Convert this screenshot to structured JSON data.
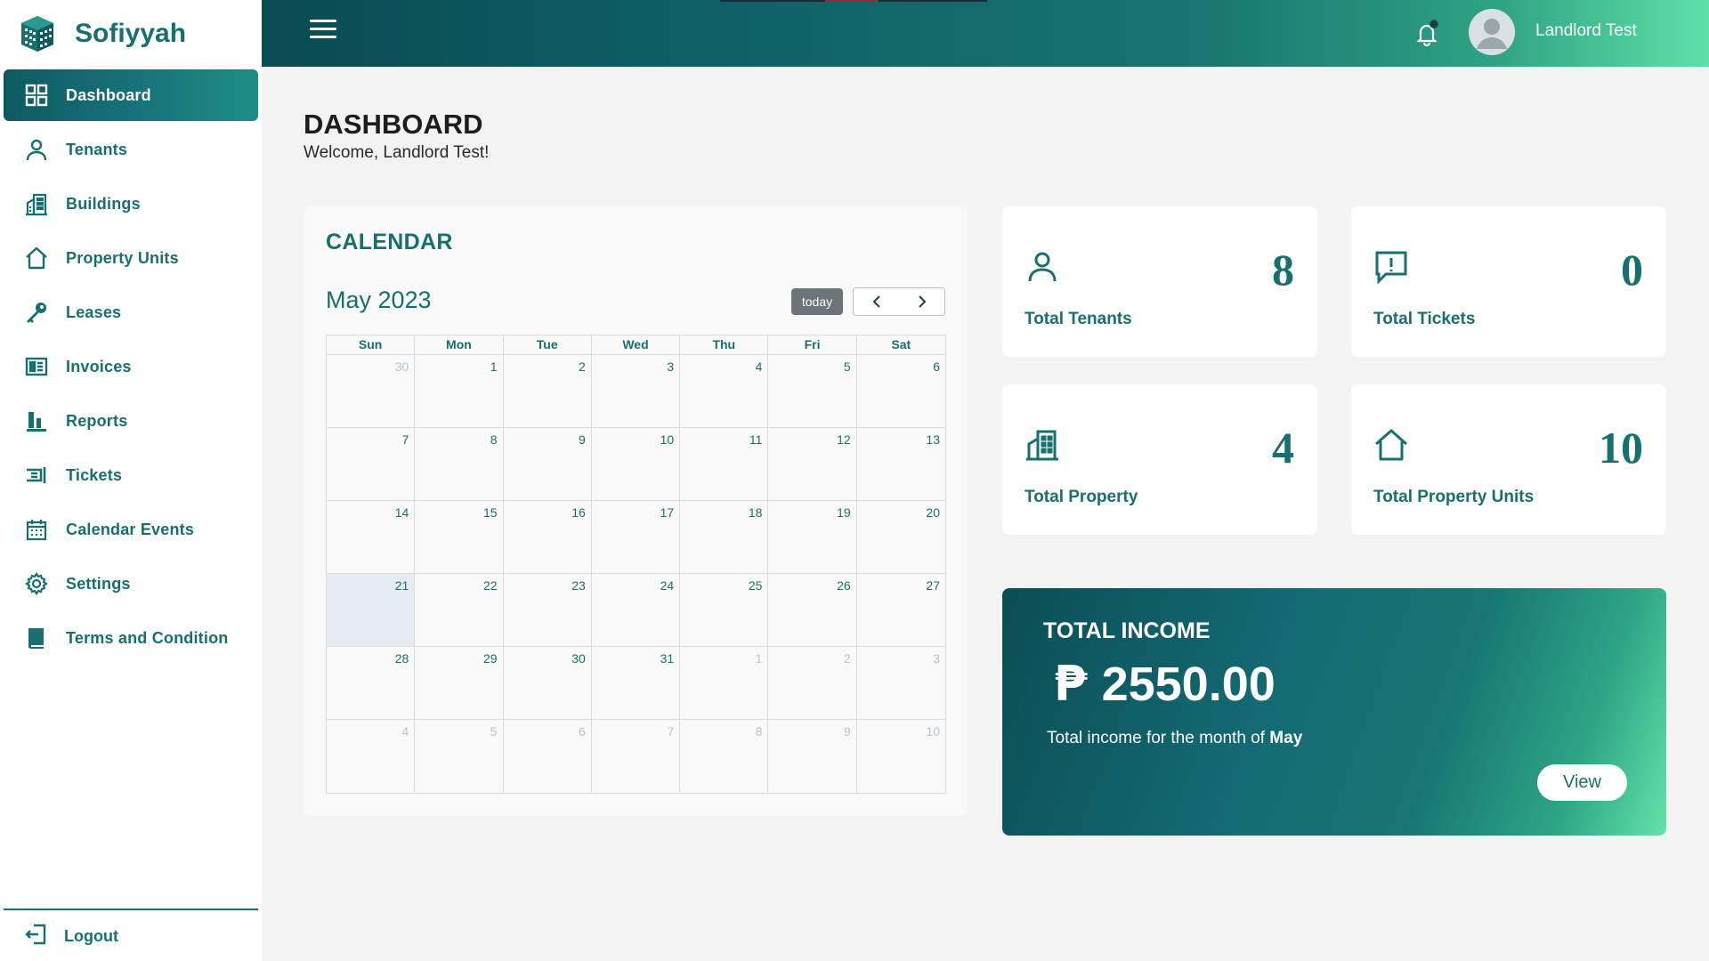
{
  "brand": {
    "name": "Sofiyyah",
    "logo_icon": "building-logo-icon"
  },
  "sidebar": {
    "items": [
      {
        "label": "Dashboard",
        "icon": "grid-icon",
        "active": true
      },
      {
        "label": "Tenants",
        "icon": "user-icon"
      },
      {
        "label": "Buildings",
        "icon": "building-icon"
      },
      {
        "label": "Property Units",
        "icon": "house-icon"
      },
      {
        "label": "Leases",
        "icon": "key-icon"
      },
      {
        "label": "Invoices",
        "icon": "invoice-icon"
      },
      {
        "label": "Reports",
        "icon": "bar-chart-icon"
      },
      {
        "label": "Tickets",
        "icon": "ticket-icon"
      },
      {
        "label": "Calendar Events",
        "icon": "calendar-icon"
      },
      {
        "label": "Settings",
        "icon": "gear-icon"
      },
      {
        "label": "Terms and Condition",
        "icon": "book-icon"
      }
    ],
    "logout_label": "Logout"
  },
  "topbar": {
    "user_name": "Landlord Test"
  },
  "header": {
    "title": "DASHBOARD",
    "welcome": "Welcome, Landlord Test!"
  },
  "calendar": {
    "title": "CALENDAR",
    "month_label": "May 2023",
    "today_label": "today",
    "prev_symbol": "‹",
    "next_symbol": "›",
    "weekdays": [
      "Sun",
      "Mon",
      "Tue",
      "Wed",
      "Thu",
      "Fri",
      "Sat"
    ],
    "weeks": [
      [
        "30",
        "1",
        "2",
        "3",
        "4",
        "5",
        "6"
      ],
      [
        "7",
        "8",
        "9",
        "10",
        "11",
        "12",
        "13"
      ],
      [
        "14",
        "15",
        "16",
        "17",
        "18",
        "19",
        "20"
      ],
      [
        "21",
        "22",
        "23",
        "24",
        "25",
        "26",
        "27"
      ],
      [
        "28",
        "29",
        "30",
        "31",
        "1",
        "2",
        "3"
      ],
      [
        "4",
        "5",
        "6",
        "7",
        "8",
        "9",
        "10"
      ]
    ],
    "today_date": "21"
  },
  "stats": {
    "tenants": {
      "label": "Total Tenants",
      "value": "8"
    },
    "tickets": {
      "label": "Total Tickets",
      "value": "0"
    },
    "property": {
      "label": "Total Property",
      "value": "4"
    },
    "units": {
      "label": "Total Property Units",
      "value": "10"
    }
  },
  "income": {
    "title": "TOTAL INCOME",
    "currency": "₱",
    "amount": "2550.00",
    "note_prefix": "Total income for the month of",
    "note_month": "May",
    "view_label": "View"
  },
  "colors": {
    "brand": "#17706f",
    "topbar_start": "#0a4a52",
    "topbar_end": "#5fe0a8",
    "today_highlight": "#e5ebf3"
  }
}
